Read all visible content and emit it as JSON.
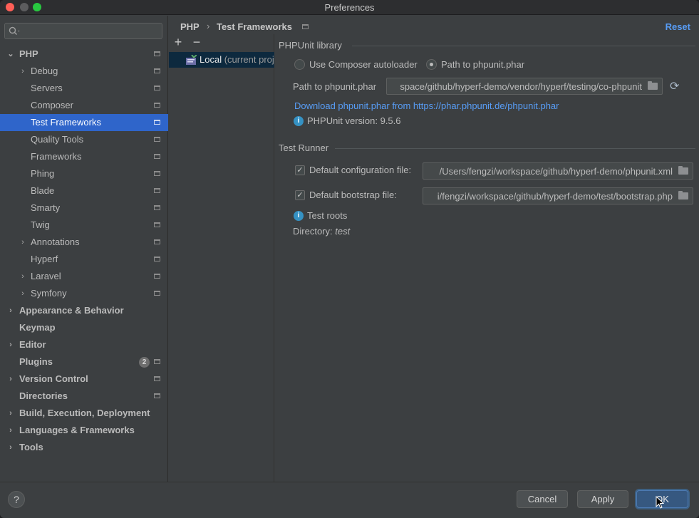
{
  "window": {
    "title": "Preferences"
  },
  "search": {
    "placeholder": ""
  },
  "sidebar": {
    "items": [
      {
        "label": "PHP",
        "arrow": "⌄"
      },
      {
        "label": "Debug",
        "arrow": "›"
      },
      {
        "label": "Servers"
      },
      {
        "label": "Composer"
      },
      {
        "label": "Test Frameworks"
      },
      {
        "label": "Quality Tools"
      },
      {
        "label": "Frameworks"
      },
      {
        "label": "Phing"
      },
      {
        "label": "Blade"
      },
      {
        "label": "Smarty"
      },
      {
        "label": "Twig"
      },
      {
        "label": "Annotations",
        "arrow": "›"
      },
      {
        "label": "Hyperf"
      },
      {
        "label": "Laravel",
        "arrow": "›"
      },
      {
        "label": "Symfony",
        "arrow": "›"
      },
      {
        "label": "Appearance & Behavior",
        "arrow": "›"
      },
      {
        "label": "Keymap"
      },
      {
        "label": "Editor",
        "arrow": "›"
      },
      {
        "label": "Plugins",
        "badge": "2"
      },
      {
        "label": "Version Control",
        "arrow": "›"
      },
      {
        "label": "Directories"
      },
      {
        "label": "Build, Execution, Deployment",
        "arrow": "›"
      },
      {
        "label": "Languages & Frameworks",
        "arrow": "›"
      },
      {
        "label": "Tools",
        "arrow": "›"
      }
    ]
  },
  "header": {
    "breadcrumb": [
      "PHP",
      "Test Frameworks"
    ],
    "separator": "›",
    "reset": "Reset"
  },
  "middle": {
    "add": "+",
    "remove": "−",
    "item": {
      "name": "Local",
      "suffix": " (current proj"
    }
  },
  "phpunit": {
    "title": "PHPUnit library",
    "radio_composer": "Use Composer autoloader",
    "radio_path": "Path to phpunit.phar",
    "path_label": "Path to phpunit.phar",
    "path_value": "space/github/hyperf-demo/vendor/hyperf/testing/co-phpunit",
    "download_link": "Download phpunit.phar from https://phar.phpunit.de/phpunit.phar",
    "version": "PHPUnit version: 9.5.6"
  },
  "test_runner": {
    "title": "Test Runner",
    "config_label": "Default configuration file:",
    "config_value": "/Users/fengzi/workspace/github/hyperf-demo/phpunit.xml",
    "bootstrap_label": "Default bootstrap file:",
    "bootstrap_value": "i/fengzi/workspace/github/hyperf-demo/test/bootstrap.php",
    "test_roots": "Test roots",
    "directory_label": "Directory:",
    "directory_value": "test"
  },
  "footer": {
    "help": "?",
    "cancel": "Cancel",
    "apply": "Apply",
    "ok": "OK"
  },
  "colors": {
    "selection": "#2f65ca",
    "link": "#589df6",
    "background": "#3c3f41"
  }
}
